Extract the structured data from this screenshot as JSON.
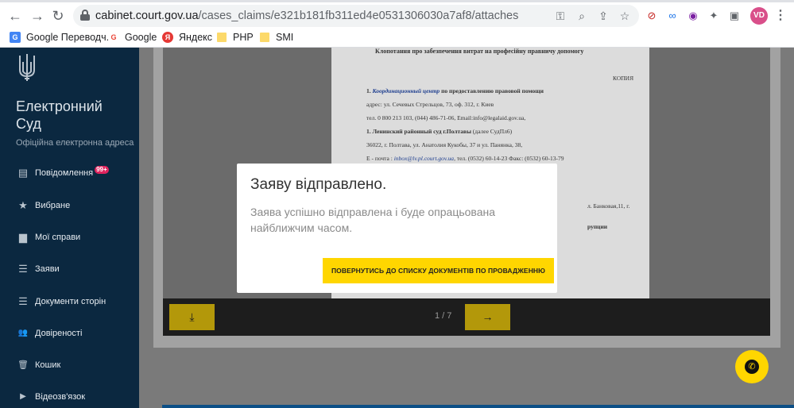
{
  "browser": {
    "back_icon": "arrow-left-icon",
    "forward_icon": "arrow-right-icon",
    "reload_icon": "reload-icon",
    "back_glyph": "←",
    "forward_glyph": "→",
    "reload_glyph": "↻",
    "url_host": "cabinet.court.gov.ua",
    "url_path": "/cases_claims/e321b181fb311ed4e0531306030a7af8/attaches",
    "avatar_text": "VD",
    "menu_glyph": "⋮",
    "omni_icons": [
      "key-icon",
      "zoom-icon",
      "share-icon",
      "star-icon"
    ],
    "omni_glyphs": [
      "⚿",
      "⌕",
      "⇪",
      "☆"
    ],
    "extension_glyphs": [
      "⊘",
      "∞",
      "◉",
      "✦",
      "▣"
    ]
  },
  "bookmarks": [
    {
      "label": "Google Переводч...",
      "icon": "google-translate-icon",
      "color": "#4285f4",
      "glyph": "G"
    },
    {
      "label": "Google",
      "icon": "google-icon",
      "color": "#ea4335",
      "glyph": "G"
    },
    {
      "label": "Яндекс",
      "icon": "yandex-icon",
      "color": "#e53935",
      "glyph": "Я"
    },
    {
      "label": "PHP",
      "icon": "folder-icon"
    },
    {
      "label": "SMI",
      "icon": "folder-icon"
    }
  ],
  "sidebar": {
    "title": "Електронний Суд",
    "subtitle": "Офіційна електронна адреса",
    "items": [
      {
        "label": "Повідомлення",
        "icon": "chat-icon",
        "glyph": "▤",
        "badge": "99+"
      },
      {
        "label": "Вибране",
        "icon": "star-icon",
        "glyph": "★"
      },
      {
        "label": "Мої справи",
        "icon": "folder-icon",
        "glyph": "▆"
      },
      {
        "label": "Заяви",
        "icon": "list-icon",
        "glyph": "☰"
      },
      {
        "label": "Документи сторін",
        "icon": "list-icon",
        "glyph": "☰"
      },
      {
        "label": "Довіреності",
        "icon": "people-icon",
        "glyph": "👥"
      },
      {
        "label": "Кошик",
        "icon": "trash-icon",
        "glyph": "🗑"
      },
      {
        "label": "Відеозв'язок",
        "icon": "video-icon",
        "glyph": "▶"
      }
    ]
  },
  "document": {
    "title": "Клопотання про забезпечення витрат на професійну правничу допомогу",
    "copy_label": "КОПИЯ",
    "line1_num": "1.",
    "line1_italic": "Координационный центр",
    "line1_rest": " по предоставлению правовой помощи",
    "line2": "адрес: ул. Сечевых Стрельцов, 73, оф. 312, г. Киев",
    "line3": "тел. 0 800 213 103, (044) 486-71-06, Email:info@legalaid.gov.ua,",
    "line4_num": "1.",
    "line4_bold": " Ленинский районный суд г.Полтавы",
    "line4_rest": " (далее СудПл6)",
    "line5": "36022, г. Полтава, ул. Анатолия Кукобы, 37 и ул. Панянка, 38,",
    "line6_pre": "E - почта : ",
    "line6_email": "inbox@lv.pl.court.gov.ua",
    "line6_post": ", тел. (0532) 60-14-23 Факс: (0532) 60-13-79",
    "fragment1": "л. Банковая,11, г.",
    "fragment2": "рупции"
  },
  "viewer": {
    "page_counter": "1 / 7",
    "download_icon": "download-icon",
    "download_glyph": "⤓",
    "next_icon": "arrow-right-icon",
    "next_glyph": "→"
  },
  "modal": {
    "title": "Заяву відправлено.",
    "message": "Заява успішно відправлена і буде опрацьована найближчим часом.",
    "button_label": "ПОВЕРНУТИСЬ ДО СПИСКУ ДОКУМЕНТІВ ПО ПРОВАДЖЕННЮ"
  },
  "call_button": {
    "icon": "phone-icon",
    "glyph": "✆"
  },
  "colors": {
    "sidebar_bg": "#0b2840",
    "accent_yellow": "#ffd600",
    "badge_red": "#e0245e",
    "overlay_grey": "#7a7a7a"
  }
}
